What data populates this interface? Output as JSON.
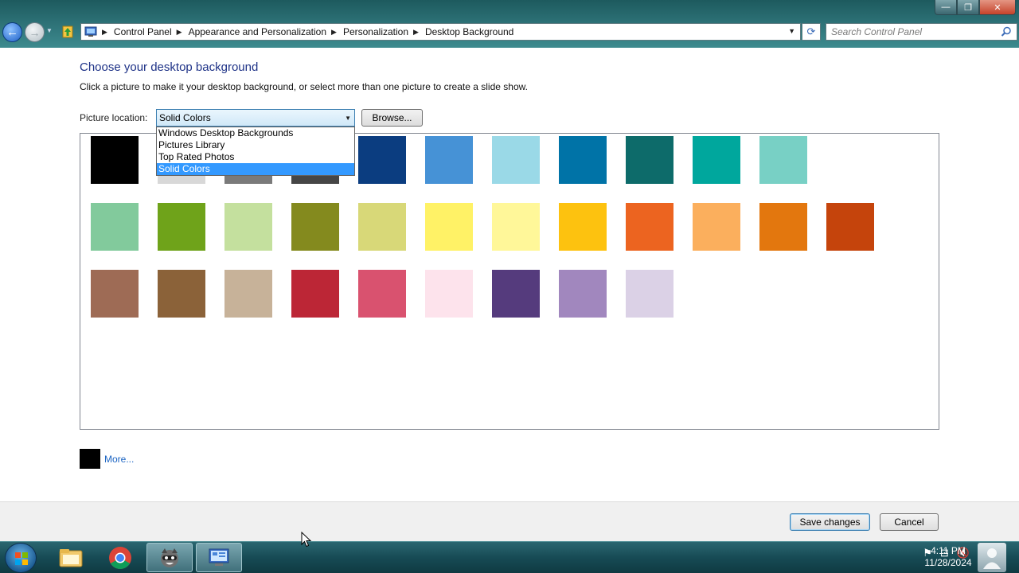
{
  "window": {
    "buttons": {
      "minimize": "—",
      "maximize": "❐",
      "close": "✕"
    }
  },
  "address_bar": {
    "breadcrumbs": [
      "Control Panel",
      "Appearance and Personalization",
      "Personalization",
      "Desktop Background"
    ]
  },
  "search": {
    "placeholder": "Search Control Panel"
  },
  "page": {
    "title": "Choose your desktop background",
    "instructions": "Click a picture to make it your desktop background, or select more than one picture to create a slide show.",
    "picture_location_label": "Picture location:",
    "picture_location_value": "Solid Colors",
    "browse_label": "Browse...",
    "dropdown_options": [
      "Windows Desktop Backgrounds",
      "Pictures Library",
      "Top Rated Photos",
      "Solid Colors"
    ],
    "dropdown_selected_index": 3,
    "more_label": "More...",
    "current_color": "#000000"
  },
  "swatches": {
    "row1": [
      "#000000",
      "#d8d8d8",
      "#7a7a7a",
      "#464646",
      "#0b3d80",
      "#4692d6",
      "#9ad9e7",
      "#0073a7",
      "#0d6b6a",
      "#00a79d",
      "#78d0c5"
    ],
    "row2": [
      "#82ca9c",
      "#6fa31a",
      "#c4e09e",
      "#848a1e",
      "#d8d878",
      "#fff266",
      "#fff799",
      "#fdc20f",
      "#ec6420",
      "#fbaf5d",
      "#e3770e",
      "#c5440c"
    ],
    "row3": [
      "#9e6b55",
      "#8b6239",
      "#c7b299",
      "#bc2636",
      "#d9526f",
      "#fde3ec",
      "#553b7d",
      "#a187be",
      "#dbd1e6"
    ]
  },
  "footer": {
    "save_label": "Save changes",
    "cancel_label": "Cancel"
  },
  "taskbar": {
    "apps": [
      "windows-explorer",
      "google-chrome",
      "raccoon-app",
      "control-panel"
    ],
    "clock_time": "4:11 PM",
    "clock_date": "11/28/2024"
  }
}
